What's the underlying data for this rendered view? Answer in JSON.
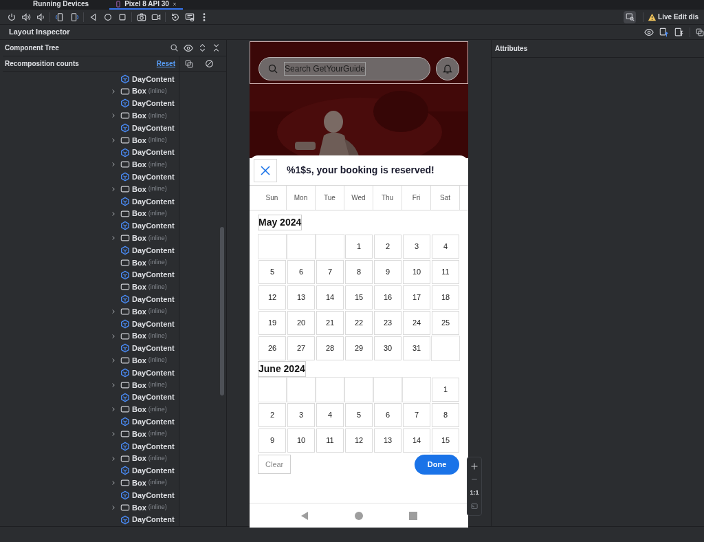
{
  "top_tabs": [
    {
      "label": "Running Devices",
      "selected": false
    },
    {
      "label": "Pixel 8 API 30",
      "selected": true
    }
  ],
  "live_edit_warning": "Live Edit dis",
  "panel_title": "Layout Inspector",
  "component_tree": {
    "title": "Component Tree",
    "recomposition_label": "Recomposition counts",
    "reset_link": "Reset",
    "rows": [
      {
        "kind": "composable",
        "label": "DayContent"
      },
      {
        "kind": "box",
        "label": "Box",
        "detail": "(inline)",
        "expandable": true
      },
      {
        "kind": "composable",
        "label": "DayContent"
      },
      {
        "kind": "box",
        "label": "Box",
        "detail": "(inline)",
        "expandable": true
      },
      {
        "kind": "composable",
        "label": "DayContent"
      },
      {
        "kind": "box",
        "label": "Box",
        "detail": "(inline)",
        "expandable": true
      },
      {
        "kind": "composable",
        "label": "DayContent"
      },
      {
        "kind": "box",
        "label": "Box",
        "detail": "(inline)",
        "expandable": true
      },
      {
        "kind": "composable",
        "label": "DayContent"
      },
      {
        "kind": "box",
        "label": "Box",
        "detail": "(inline)",
        "expandable": true
      },
      {
        "kind": "composable",
        "label": "DayContent"
      },
      {
        "kind": "box",
        "label": "Box",
        "detail": "(inline)",
        "expandable": true
      },
      {
        "kind": "composable",
        "label": "DayContent"
      },
      {
        "kind": "box",
        "label": "Box",
        "detail": "(inline)",
        "expandable": true
      },
      {
        "kind": "composable",
        "label": "DayContent"
      },
      {
        "kind": "box",
        "label": "Box",
        "detail": "(inline)",
        "expandable": false
      },
      {
        "kind": "composable",
        "label": "DayContent"
      },
      {
        "kind": "box",
        "label": "Box",
        "detail": "(inline)",
        "expandable": false
      },
      {
        "kind": "composable",
        "label": "DayContent"
      },
      {
        "kind": "box",
        "label": "Box",
        "detail": "(inline)",
        "expandable": true
      },
      {
        "kind": "composable",
        "label": "DayContent"
      },
      {
        "kind": "box",
        "label": "Box",
        "detail": "(inline)",
        "expandable": true
      },
      {
        "kind": "composable",
        "label": "DayContent"
      },
      {
        "kind": "box",
        "label": "Box",
        "detail": "(inline)",
        "expandable": true
      },
      {
        "kind": "composable",
        "label": "DayContent"
      },
      {
        "kind": "box",
        "label": "Box",
        "detail": "(inline)",
        "expandable": true
      },
      {
        "kind": "composable",
        "label": "DayContent"
      },
      {
        "kind": "box",
        "label": "Box",
        "detail": "(inline)",
        "expandable": true
      },
      {
        "kind": "composable",
        "label": "DayContent"
      },
      {
        "kind": "box",
        "label": "Box",
        "detail": "(inline)",
        "expandable": true
      },
      {
        "kind": "composable",
        "label": "DayContent"
      },
      {
        "kind": "box",
        "label": "Box",
        "detail": "(inline)",
        "expandable": true
      },
      {
        "kind": "composable",
        "label": "DayContent"
      },
      {
        "kind": "box",
        "label": "Box",
        "detail": "(inline)",
        "expandable": true
      },
      {
        "kind": "composable",
        "label": "DayContent"
      },
      {
        "kind": "box",
        "label": "Box",
        "detail": "(inline)",
        "expandable": true
      },
      {
        "kind": "composable",
        "label": "DayContent"
      }
    ]
  },
  "attributes": {
    "title": "Attributes"
  },
  "device": {
    "search": {
      "placeholder": "Search GetYourGuide"
    },
    "sheet_title": "%1$s, your booking is reserved!",
    "weekdays": [
      "Sun",
      "Mon",
      "Tue",
      "Wed",
      "Thu",
      "Fri",
      "Sat"
    ],
    "months": [
      {
        "title": "May 2024",
        "weeks": [
          [
            {
              "kind": "empty"
            },
            {
              "kind": "empty"
            },
            {
              "kind": "empty"
            },
            {
              "kind": "day",
              "label": "1"
            },
            {
              "kind": "day",
              "label": "2"
            },
            {
              "kind": "day",
              "label": "3"
            },
            {
              "kind": "day",
              "label": "4"
            }
          ],
          [
            {
              "kind": "day",
              "label": "5"
            },
            {
              "kind": "day",
              "label": "6"
            },
            {
              "kind": "day",
              "label": "7"
            },
            {
              "kind": "day",
              "label": "8"
            },
            {
              "kind": "day",
              "label": "9"
            },
            {
              "kind": "day",
              "label": "10"
            },
            {
              "kind": "day",
              "label": "11"
            }
          ],
          [
            {
              "kind": "day",
              "label": "12"
            },
            {
              "kind": "day",
              "label": "13"
            },
            {
              "kind": "day",
              "label": "14"
            },
            {
              "kind": "day",
              "label": "15"
            },
            {
              "kind": "day",
              "label": "16"
            },
            {
              "kind": "day",
              "label": "17"
            },
            {
              "kind": "day",
              "label": "18"
            }
          ],
          [
            {
              "kind": "day",
              "label": "19"
            },
            {
              "kind": "day",
              "label": "20"
            },
            {
              "kind": "day",
              "label": "21"
            },
            {
              "kind": "day",
              "label": "22"
            },
            {
              "kind": "day",
              "label": "23"
            },
            {
              "kind": "day",
              "label": "24"
            },
            {
              "kind": "day",
              "label": "25"
            }
          ],
          [
            {
              "kind": "day",
              "label": "26"
            },
            {
              "kind": "day",
              "label": "27"
            },
            {
              "kind": "day",
              "label": "28"
            },
            {
              "kind": "day",
              "label": "29"
            },
            {
              "kind": "day",
              "label": "30"
            },
            {
              "kind": "day",
              "label": "31"
            },
            {
              "kind": "empty"
            }
          ]
        ]
      },
      {
        "title": "June 2024",
        "weeks": [
          [
            {
              "kind": "empty"
            },
            {
              "kind": "empty"
            },
            {
              "kind": "empty"
            },
            {
              "kind": "empty"
            },
            {
              "kind": "empty"
            },
            {
              "kind": "empty"
            },
            {
              "kind": "day",
              "label": "1"
            }
          ],
          [
            {
              "kind": "day",
              "label": "2"
            },
            {
              "kind": "day",
              "label": "3"
            },
            {
              "kind": "day",
              "label": "4"
            },
            {
              "kind": "day",
              "label": "5"
            },
            {
              "kind": "day",
              "label": "6"
            },
            {
              "kind": "day",
              "label": "7"
            },
            {
              "kind": "day",
              "label": "8"
            }
          ],
          [
            {
              "kind": "day",
              "label": "9"
            },
            {
              "kind": "day",
              "label": "10"
            },
            {
              "kind": "day",
              "label": "11"
            },
            {
              "kind": "day",
              "label": "12"
            },
            {
              "kind": "day",
              "label": "13"
            },
            {
              "kind": "day",
              "label": "14"
            },
            {
              "kind": "day",
              "label": "15"
            }
          ]
        ]
      }
    ],
    "clear_button": "Clear",
    "done_button": "Done"
  },
  "zoom_controls": {
    "actual_size": "1:1"
  }
}
